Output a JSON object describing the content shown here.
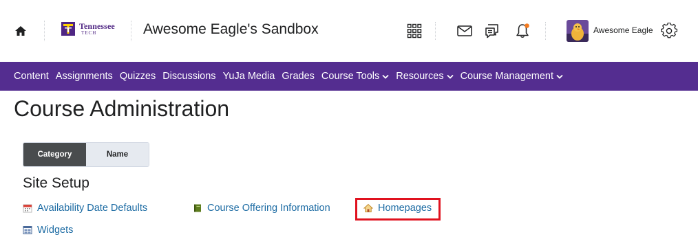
{
  "header": {
    "logo": {
      "name": "Tennessee",
      "sub": "TECH"
    },
    "course_title": "Awesome Eagle's Sandbox",
    "user_name": "Awesome Eagle",
    "icons": [
      "home-icon",
      "waffle-grid-icon",
      "mail-icon",
      "chat-icon",
      "bell-icon",
      "gear-icon"
    ],
    "notification_color": "#f47b20"
  },
  "nav": {
    "items": [
      {
        "label": "Content"
      },
      {
        "label": "Assignments"
      },
      {
        "label": "Quizzes"
      },
      {
        "label": "Discussions"
      },
      {
        "label": "YuJa Media"
      },
      {
        "label": "Grades"
      },
      {
        "label": "Course Tools",
        "dropdown": true
      },
      {
        "label": "Resources",
        "dropdown": true
      },
      {
        "label": "Course Management",
        "dropdown": true
      }
    ],
    "background": "#542d90"
  },
  "page": {
    "title": "Course Administration",
    "view_toggle": {
      "category": "Category",
      "name": "Name",
      "selected": "Category"
    },
    "section": {
      "title": "Site Setup",
      "links": [
        {
          "label": "Availability Date Defaults",
          "icon": "calendar-icon"
        },
        {
          "label": "Course Offering Information",
          "icon": "book-icon"
        },
        {
          "label": "Homepages",
          "icon": "house-icon",
          "highlighted": true
        },
        {
          "label": "Widgets",
          "icon": "widgets-icon"
        }
      ]
    },
    "link_color": "#1c6ba3",
    "highlight_color": "#e0121f"
  }
}
